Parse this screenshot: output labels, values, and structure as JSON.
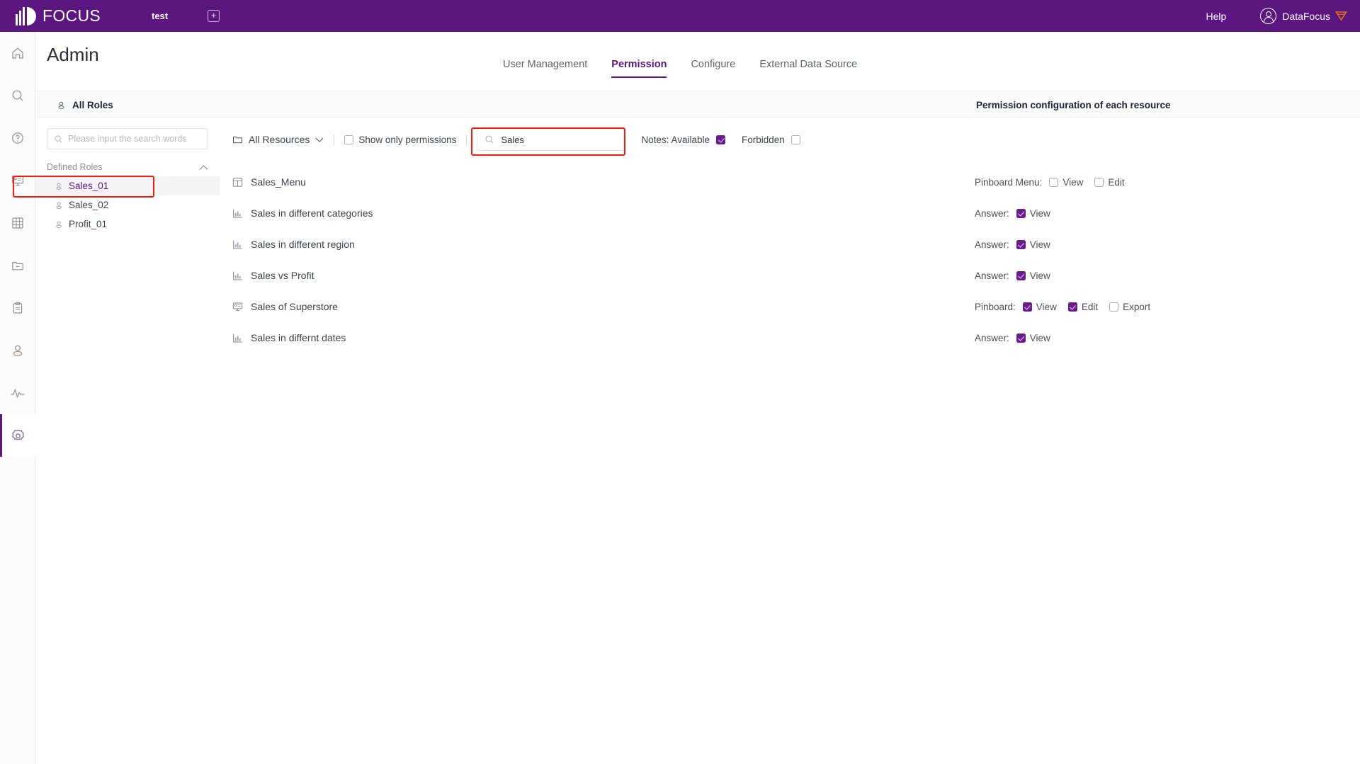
{
  "topbar": {
    "brand_name": "FOCUS",
    "workspace_tab": "test",
    "add_tab_icon": "plus-icon",
    "help_label": "Help",
    "user_name": "DataFocus",
    "brand_color": "#5b1680",
    "badge_color": "#e2700f"
  },
  "rail": {
    "items": [
      {
        "icon": "home-icon",
        "name": "home",
        "active": false
      },
      {
        "icon": "search-icon",
        "name": "search",
        "active": false
      },
      {
        "icon": "help-circle-icon",
        "name": "help",
        "active": false
      },
      {
        "icon": "presentation-icon",
        "name": "pinboard",
        "active": false
      },
      {
        "icon": "table-grid-icon",
        "name": "data-table",
        "active": false
      },
      {
        "icon": "folder-minus-icon",
        "name": "resources",
        "active": false
      },
      {
        "icon": "clipboard-icon",
        "name": "tasks",
        "active": false
      },
      {
        "icon": "user-icon",
        "name": "profile",
        "active": false
      },
      {
        "icon": "activity-icon",
        "name": "monitoring",
        "active": false
      },
      {
        "icon": "gear-icon",
        "name": "admin-settings",
        "active": true
      }
    ]
  },
  "header": {
    "title": "Admin",
    "tabs": [
      {
        "label": "User Management",
        "active": false
      },
      {
        "label": "Permission",
        "active": true
      },
      {
        "label": "Configure",
        "active": false
      },
      {
        "label": "External Data Source",
        "active": false
      }
    ]
  },
  "section_bar": {
    "roles_title": "All Roles",
    "roles_icon": "user-icon",
    "permission_title": "Permission configuration of each resource"
  },
  "roles_panel": {
    "search_placeholder": "Please input the search words",
    "search_value": "",
    "search_icon": "search-icon",
    "group_label": "Defined Roles",
    "group_collapse_icon": "chevron-up-icon",
    "items": [
      {
        "label": "Sales_01",
        "icon": "user-icon",
        "selected": true,
        "highlighted": true
      },
      {
        "label": "Sales_02",
        "icon": "user-icon",
        "selected": false,
        "highlighted": false
      },
      {
        "label": "Profit_01",
        "icon": "user-icon",
        "selected": false,
        "highlighted": false
      }
    ]
  },
  "toolbar": {
    "all_resources_label": "All Resources",
    "all_resources_icon": "folder-icon",
    "all_resources_chevron": "chevron-down-icon",
    "show_only_permissions_label": "Show only permissions",
    "show_only_permissions_checked": false,
    "search_placeholder": "",
    "search_value": "Sales",
    "search_icon": "search-icon",
    "search_highlighted": true,
    "notes_label": "Notes: Available",
    "notes_checked": true,
    "forbidden_label": "Forbidden",
    "forbidden_checked": false
  },
  "resources": [
    {
      "name": "Sales_Menu",
      "icon": "menu-board-icon",
      "perm_type": "Pinboard Menu:",
      "permissions": [
        {
          "label": "View",
          "checked": false
        },
        {
          "label": "Edit",
          "checked": false
        }
      ]
    },
    {
      "name": "Sales in different categories",
      "icon": "bar-chart-icon",
      "perm_type": "Answer:",
      "permissions": [
        {
          "label": "View",
          "checked": true
        }
      ]
    },
    {
      "name": "Sales in different region",
      "icon": "bar-chart-icon",
      "perm_type": "Answer:",
      "permissions": [
        {
          "label": "View",
          "checked": true
        }
      ]
    },
    {
      "name": "Sales vs Profit",
      "icon": "bar-chart-icon",
      "perm_type": "Answer:",
      "permissions": [
        {
          "label": "View",
          "checked": true
        }
      ]
    },
    {
      "name": "Sales of Superstore",
      "icon": "presentation-icon",
      "perm_type": "Pinboard:",
      "permissions": [
        {
          "label": "View",
          "checked": true
        },
        {
          "label": "Edit",
          "checked": true
        },
        {
          "label": "Export",
          "checked": false
        }
      ]
    },
    {
      "name": "Sales in differnt dates",
      "icon": "bar-chart-icon",
      "perm_type": "Answer:",
      "permissions": [
        {
          "label": "View",
          "checked": true
        }
      ]
    }
  ],
  "colors": {
    "accent": "#5b1680",
    "checkbox_checked": "#6a1b8f",
    "highlight_box": "#fb1b08",
    "text": "#3d4350"
  }
}
